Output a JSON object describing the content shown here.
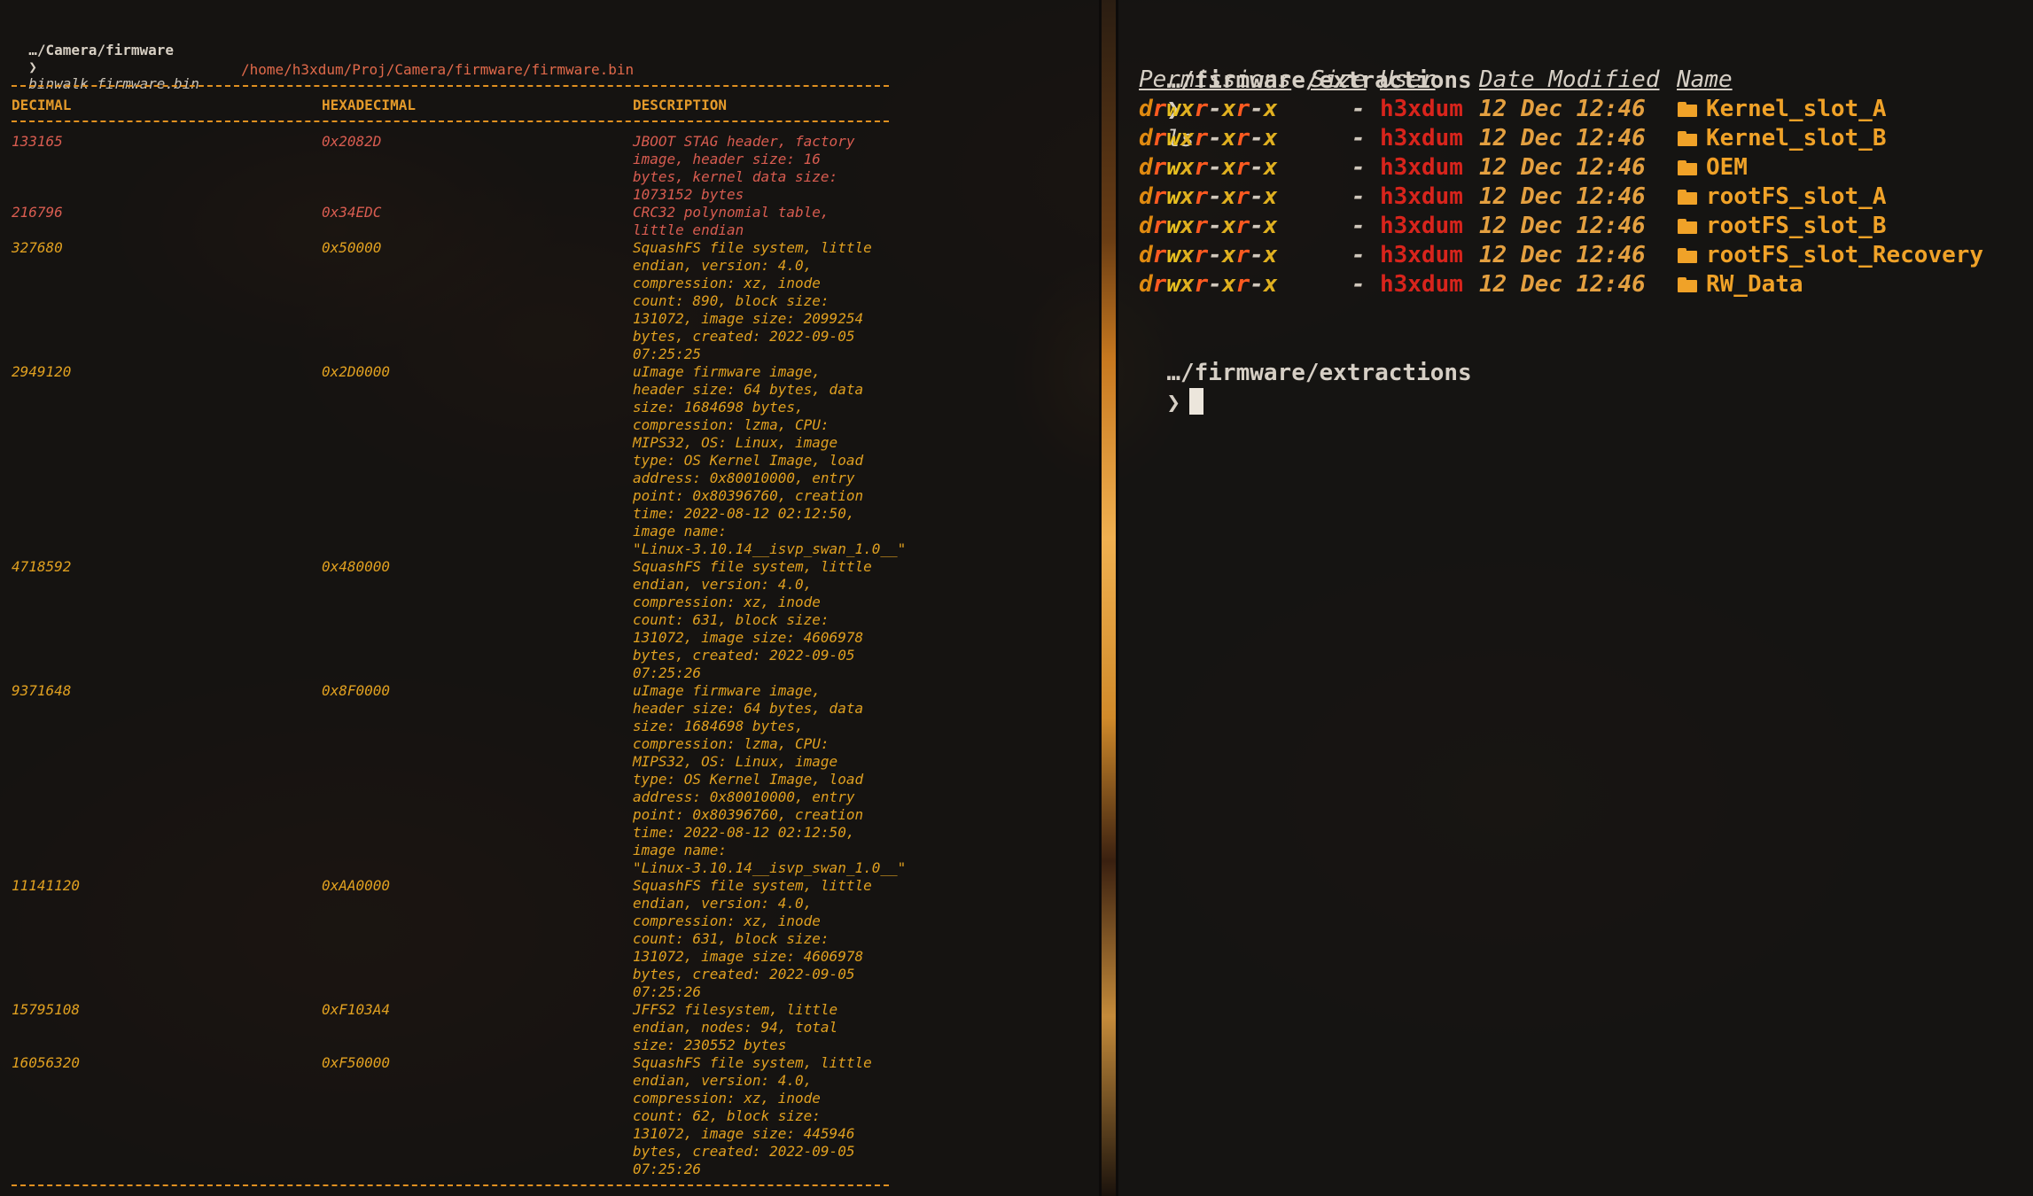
{
  "left": {
    "prompt_path": "…/Camera/firmware",
    "prompt_symbol": "❯",
    "command": "binwalk firmware.bin",
    "file_path": "/home/h3xdum/Proj/Camera/firmware/firmware.bin",
    "columns": [
      "DECIMAL",
      "HEXADECIMAL",
      "DESCRIPTION"
    ],
    "rows": [
      {
        "decimal": "133165",
        "hex": "0x2082D",
        "description": "JBOOT STAG header, factory\nimage, header size: 16\nbytes, kernel data size:\n1073152 bytes",
        "color": "red"
      },
      {
        "decimal": "216796",
        "hex": "0x34EDC",
        "description": "CRC32 polynomial table,\nlittle endian",
        "color": "red"
      },
      {
        "decimal": "327680",
        "hex": "0x50000",
        "description": "SquashFS file system, little\nendian, version: 4.0,\ncompression: xz, inode\ncount: 890, block size:\n131072, image size: 2099254\nbytes, created: 2022-09-05\n07:25:25",
        "color": "yellow"
      },
      {
        "decimal": "2949120",
        "hex": "0x2D0000",
        "description": "uImage firmware image,\nheader size: 64 bytes, data\nsize: 1684698 bytes,\ncompression: lzma, CPU:\nMIPS32, OS: Linux, image\ntype: OS Kernel Image, load\naddress: 0x80010000, entry\npoint: 0x80396760, creation\ntime: 2022-08-12 02:12:50,\nimage name:\n\"Linux-3.10.14__isvp_swan_1.0__\"",
        "color": "yellow"
      },
      {
        "decimal": "4718592",
        "hex": "0x480000",
        "description": "SquashFS file system, little\nendian, version: 4.0,\ncompression: xz, inode\ncount: 631, block size:\n131072, image size: 4606978\nbytes, created: 2022-09-05\n07:25:26",
        "color": "yellow"
      },
      {
        "decimal": "9371648",
        "hex": "0x8F0000",
        "description": "uImage firmware image,\nheader size: 64 bytes, data\nsize: 1684698 bytes,\ncompression: lzma, CPU:\nMIPS32, OS: Linux, image\ntype: OS Kernel Image, load\naddress: 0x80010000, entry\npoint: 0x80396760, creation\ntime: 2022-08-12 02:12:50,\nimage name:\n\"Linux-3.10.14__isvp_swan_1.0__\"",
        "color": "yellow"
      },
      {
        "decimal": "11141120",
        "hex": "0xAA0000",
        "description": "SquashFS file system, little\nendian, version: 4.0,\ncompression: xz, inode\ncount: 631, block size:\n131072, image size: 4606978\nbytes, created: 2022-09-05\n07:25:26",
        "color": "yellow"
      },
      {
        "decimal": "15795108",
        "hex": "0xF103A4",
        "description": "JFFS2 filesystem, little\nendian, nodes: 94, total\nsize: 230552 bytes",
        "color": "yellow"
      },
      {
        "decimal": "16056320",
        "hex": "0xF50000",
        "description": "SquashFS file system, little\nendian, version: 4.0,\ncompression: xz, inode\ncount: 62, block size:\n131072, image size: 445946\nbytes, created: 2022-09-05\n07:25:26",
        "color": "yellow"
      }
    ]
  },
  "right": {
    "prompt_path": "…/firmware/extractions",
    "prompt_symbol": "❯",
    "command": "ls",
    "headers": {
      "permissions": "Permissions",
      "size": "Size",
      "user": "User",
      "date": "Date Modified",
      "name": "Name"
    },
    "entries": [
      {
        "permissions": "drwxr-xr-x",
        "size": "-",
        "user": "h3xdum",
        "date": "12 Dec 12:46",
        "icon": "folder-icon",
        "name": "Kernel_slot_A"
      },
      {
        "permissions": "drwxr-xr-x",
        "size": "-",
        "user": "h3xdum",
        "date": "12 Dec 12:46",
        "icon": "folder-icon",
        "name": "Kernel_slot_B"
      },
      {
        "permissions": "drwxr-xr-x",
        "size": "-",
        "user": "h3xdum",
        "date": "12 Dec 12:46",
        "icon": "folder-icon",
        "name": "OEM"
      },
      {
        "permissions": "drwxr-xr-x",
        "size": "-",
        "user": "h3xdum",
        "date": "12 Dec 12:46",
        "icon": "folder-icon",
        "name": "rootFS_slot_A"
      },
      {
        "permissions": "drwxr-xr-x",
        "size": "-",
        "user": "h3xdum",
        "date": "12 Dec 12:46",
        "icon": "folder-icon",
        "name": "rootFS_slot_B"
      },
      {
        "permissions": "drwxr-xr-x",
        "size": "-",
        "user": "h3xdum",
        "date": "12 Dec 12:46",
        "icon": "folder-icon",
        "name": "rootFS_slot_Recovery"
      },
      {
        "permissions": "drwxr-xr-x",
        "size": "-",
        "user": "h3xdum",
        "date": "12 Dec 12:46",
        "icon": "folder-icon",
        "name": "RW_Data"
      }
    ],
    "prompt2_path": "…/firmware/extractions",
    "prompt2_symbol": "❯"
  },
  "colors": {
    "accent_orange": "#e0a020",
    "red_text": "#d85c50",
    "user_red": "#d8241c",
    "folder_orange": "#f0a228"
  }
}
